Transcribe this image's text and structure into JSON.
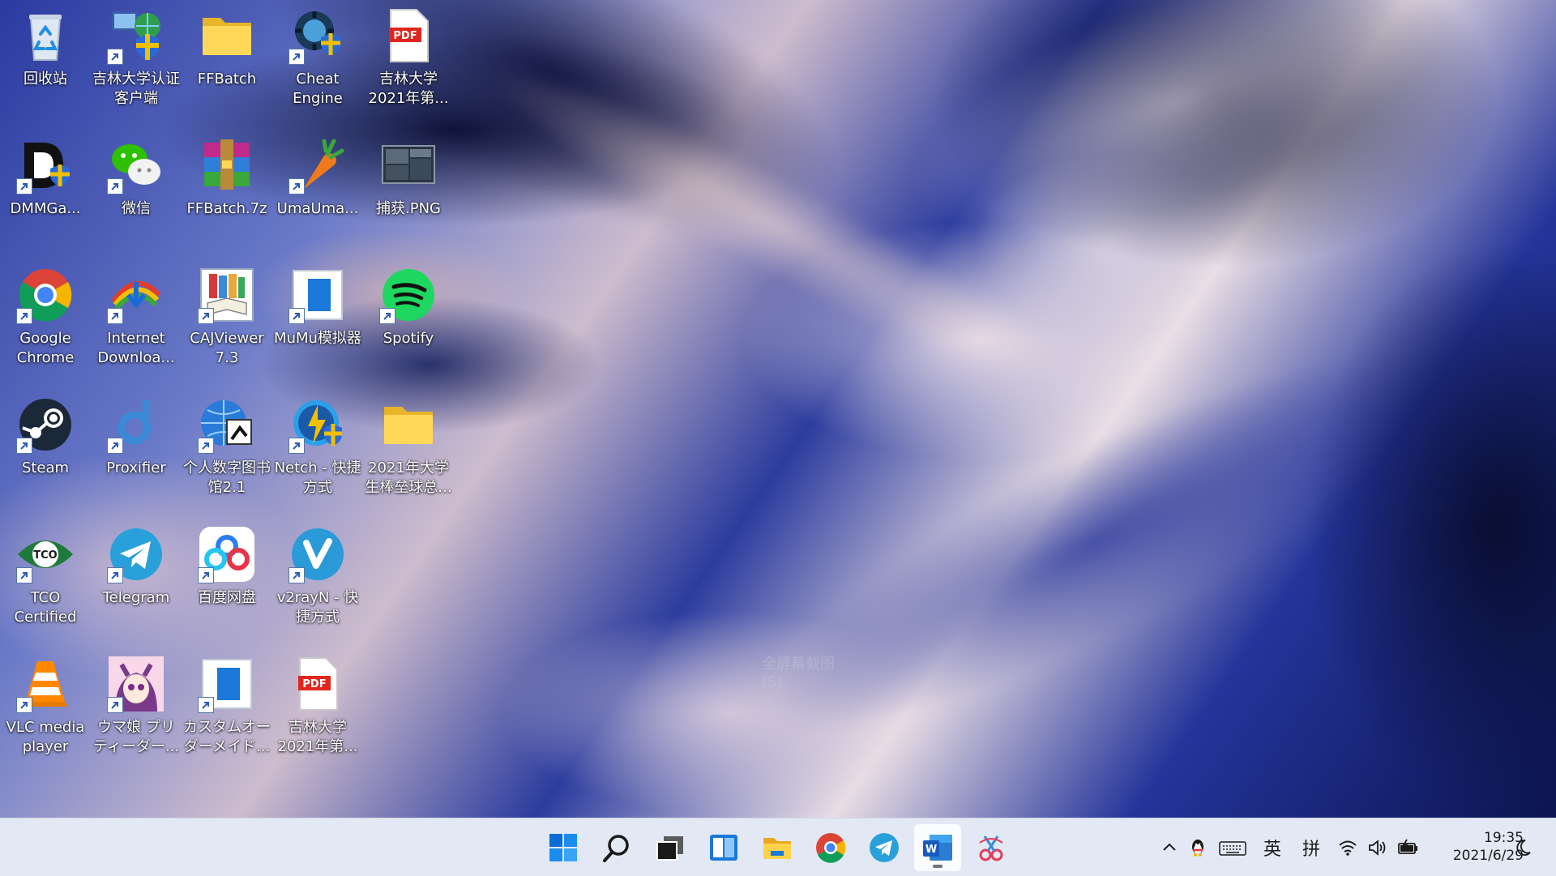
{
  "desktop": {
    "icons": [
      {
        "label": "回收站",
        "icon": "recycle-bin-icon"
      },
      {
        "label": "吉林大学认证客户端",
        "icon": "network-client-icon"
      },
      {
        "label": "FFBatch",
        "icon": "folder-icon"
      },
      {
        "label": "Cheat Engine",
        "icon": "cheat-engine-icon"
      },
      {
        "label": "吉林大学2021年第...",
        "icon": "pdf-icon"
      },
      {
        "label": "DMMGa...",
        "icon": "dmm-games-icon"
      },
      {
        "label": "微信",
        "icon": "wechat-icon"
      },
      {
        "label": "FFBatch.7z",
        "icon": "winrar-archive-icon"
      },
      {
        "label": "UmaUma...",
        "icon": "carrot-icon"
      },
      {
        "label": "捕获.PNG",
        "icon": "image-file-icon"
      },
      {
        "label": "Google Chrome",
        "icon": "chrome-icon"
      },
      {
        "label": "Internet Downloa...",
        "icon": "internet-download-manager-icon"
      },
      {
        "label": "CAJViewer 7.3",
        "icon": "cajviewer-icon"
      },
      {
        "label": "MuMu模拟器",
        "icon": "mumu-emulator-icon"
      },
      {
        "label": "Spotify",
        "icon": "spotify-icon"
      },
      {
        "label": "Steam",
        "icon": "steam-icon"
      },
      {
        "label": "Proxifier",
        "icon": "proxifier-icon"
      },
      {
        "label": "个人数字图书馆2.1",
        "icon": "digital-library-icon"
      },
      {
        "label": "Netch - 快捷方式",
        "icon": "netch-icon"
      },
      {
        "label": "2021年大学生棒垒球总...",
        "icon": "folder-icon"
      },
      {
        "label": "TCO Certified",
        "icon": "tco-certified-icon"
      },
      {
        "label": "Telegram",
        "icon": "telegram-icon"
      },
      {
        "label": "百度网盘",
        "icon": "baidu-netdisk-icon"
      },
      {
        "label": "v2rayN - 快捷方式",
        "icon": "v2rayn-icon"
      },
      {
        "label": "VLC media player",
        "icon": "vlc-icon"
      },
      {
        "label": "ウマ娘 プリティーダー...",
        "icon": "umamusume-icon"
      },
      {
        "label": "カスタムオーダーメイド...",
        "icon": "custom-order-maid-icon"
      },
      {
        "label": "吉林大学2021年第...",
        "icon": "pdf-icon"
      }
    ],
    "watermark": "全屏幕截图(S)"
  },
  "taskbar": {
    "apps": [
      {
        "name": "start",
        "icon": "windows-start-icon"
      },
      {
        "name": "search",
        "icon": "search-icon"
      },
      {
        "name": "task-view",
        "icon": "task-view-icon"
      },
      {
        "name": "widgets",
        "icon": "widgets-icon"
      },
      {
        "name": "file-explorer",
        "icon": "file-explorer-icon"
      },
      {
        "name": "chrome",
        "icon": "chrome-icon"
      },
      {
        "name": "telegram",
        "icon": "telegram-icon"
      },
      {
        "name": "word",
        "icon": "word-icon",
        "active": true
      },
      {
        "name": "snipping-tool",
        "icon": "snipping-tool-icon"
      }
    ],
    "tray": {
      "ime_lang": "英",
      "ime_mode": "拼",
      "time": "19:35",
      "date": "2021/6/29"
    }
  },
  "colors": {
    "taskbar_bg": "#e1e8f4",
    "accent_blue": "#0a6cd6",
    "chrome_red": "#db4437",
    "chrome_yellow": "#f4b400",
    "chrome_green": "#0f9d58",
    "telegram_blue": "#2aa0da",
    "spotify_green": "#1ed760"
  }
}
